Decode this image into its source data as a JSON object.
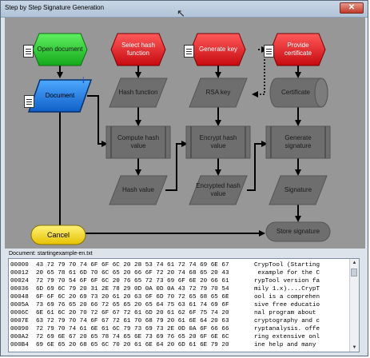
{
  "window": {
    "title": "Step by Step Signature Generation",
    "close_glyph": "✕"
  },
  "nodes": {
    "open_document": "Open document",
    "document": "Document",
    "select_hash": "Select hash function",
    "hash_function": "Hash function",
    "compute_hash": "Compute hash value",
    "hash_value": "Hash value",
    "generate_key": "Generate key",
    "rsa_key": "RSA key",
    "encrypt_hash": "Encrypt hash value",
    "encrypted_hash": "Encrypted hash value",
    "provide_certificate": "Provide certificate",
    "certificate": "Certificate",
    "generate_signature": "Generate signature",
    "signature": "Signature",
    "store_signature": "Store signature",
    "cancel": "Cancel"
  },
  "colors": {
    "start_green": "#22c42a",
    "start_red": "#e8141a",
    "document_blue": "#1e7fe0",
    "cancel_yellow": "#f0d000",
    "gray_node": "#6e6e6e",
    "canvas": "#979797"
  },
  "icons": {
    "doc": "document-icon",
    "info": "info-icon"
  },
  "status": {
    "document_label": "Document: startingexample-en.txt"
  },
  "hex_rows": [
    {
      "offset": "00000",
      "hex": "43 72 79 70 74 6F 6F 6C 20 28 53 74 61 72 74 69 6E 67",
      "text": "CrypTool (Starting"
    },
    {
      "offset": "00012",
      "hex": "20 65 78 61 6D 70 6C 65 20 66 6F 72 20 74 68 65 20 43",
      "text": " example for the C"
    },
    {
      "offset": "00024",
      "hex": "72 79 70 54 6F 6F 6C 20 76 65 72 73 69 6F 6E 20 66 61",
      "text": "rypTool version fa"
    },
    {
      "offset": "00036",
      "hex": "6D 69 6C 79 20 31 2E 78 29 0D 0A 0D 0A 43 72 79 70 54",
      "text": "mily 1.x)....CrypT"
    },
    {
      "offset": "00048",
      "hex": "6F 6F 6C 20 69 73 20 61 20 63 6F 6D 70 72 65 68 65 6E",
      "text": "ool is a comprehen"
    },
    {
      "offset": "0005A",
      "hex": "73 69 76 65 20 66 72 65 65 20 65 64 75 63 61 74 69 6F",
      "text": "sive free educatio"
    },
    {
      "offset": "0006C",
      "hex": "6E 61 6C 20 70 72 6F 67 72 61 6D 20 61 62 6F 75 74 20",
      "text": "nal program about "
    },
    {
      "offset": "0007E",
      "hex": "63 72 79 70 74 6F 67 72 61 70 68 79 20 61 6E 64 20 63",
      "text": "cryptography and c"
    },
    {
      "offset": "00090",
      "hex": "72 79 70 74 61 6E 61 6C 79 73 69 73 2E 0D 0A 6F 66 66",
      "text": "ryptanalysis. offe"
    },
    {
      "offset": "000A2",
      "hex": "72 69 6E 67 20 65 78 74 65 6E 73 69 76 65 20 6F 6E 6C",
      "text": "ring extensive onl"
    },
    {
      "offset": "000B4",
      "hex": "69 6E 65 20 68 65 6C 70 20 61 6E 64 20 6D 61 6E 79 20",
      "text": "ine help and many "
    }
  ]
}
